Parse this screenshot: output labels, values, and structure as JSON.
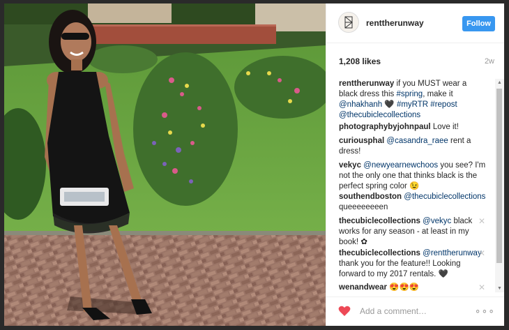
{
  "post": {
    "username": "renttherunway",
    "follow_label": "Follow",
    "likes": "1,208 likes",
    "age": "2w",
    "caption": {
      "username": "renttherunway",
      "text1": "if you MUST wear a black dress this",
      "tag1": "#spring",
      "text2": ", make it",
      "mention1": "@nhakhanh",
      "emoji": "🖤",
      "tag2": "#myRTR",
      "tag3": "#repost",
      "mention2": "@thecubiclecollections"
    },
    "comments": [
      {
        "user": "photographybyjohnpaul",
        "text": "Love it!"
      },
      {
        "user": "curiousphal",
        "mention": "@casandra_raee",
        "text": "rent a dress!"
      },
      {
        "user": "vekyc",
        "mention": "@newyearnewchoos",
        "text": "you see? I'm not the only one that thinks black is the perfect spring color 😉"
      },
      {
        "user": "southendboston",
        "mention": "@thecubiclecollections",
        "text": "queeeeeeeen"
      },
      {
        "user": "thecubiclecollections",
        "mention": "@vekyc",
        "text": "black works for any season - at least in my book! ✿"
      },
      {
        "user": "thecubiclecollections",
        "mention": "@renttherunway",
        "text": "thank you for the feature!! Looking forward to my 2017 rentals. 🖤"
      },
      {
        "user": "wenandwear",
        "text": "😍😍😍"
      }
    ],
    "add_comment_placeholder": "Add a comment…",
    "more_glyph": "∘∘∘",
    "close_glyph": "✕"
  },
  "colors": {
    "accent": "#3897f0",
    "like_heart": "#ed4956",
    "mention": "#003569"
  },
  "icons": {
    "heart": "heart-icon",
    "avatar": "renttherunway-logo",
    "more": "more-options-icon"
  }
}
